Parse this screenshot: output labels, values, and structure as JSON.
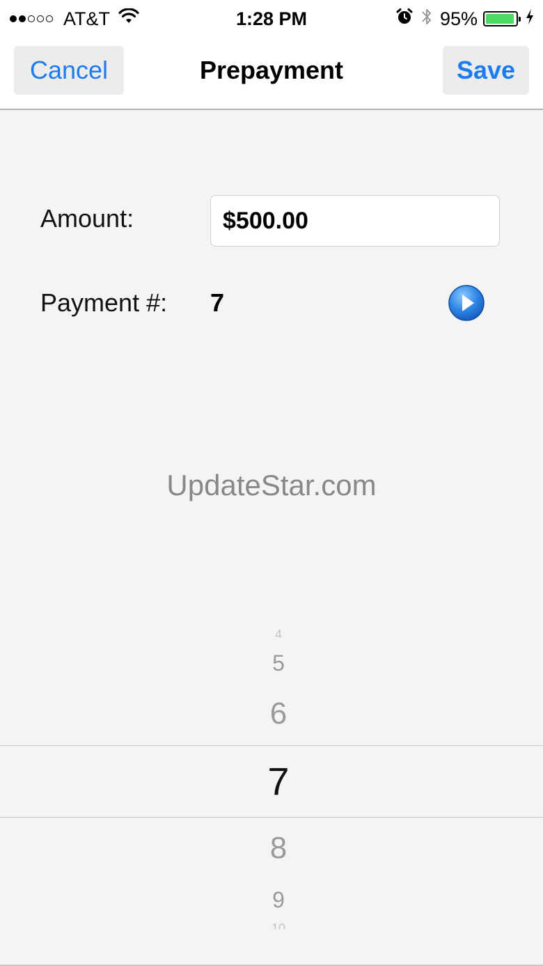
{
  "status_bar": {
    "carrier": "AT&T",
    "time": "1:28 PM",
    "battery_percent": "95%",
    "battery_level": 0.95,
    "signal_bars_filled": 2,
    "signal_bars_total": 5,
    "icons": [
      "wifi-icon",
      "alarm-icon",
      "bluetooth-icon",
      "battery-icon",
      "charging-icon"
    ]
  },
  "nav": {
    "title": "Prepayment",
    "cancel_label": "Cancel",
    "save_label": "Save"
  },
  "form": {
    "amount_label": "Amount:",
    "amount_value": "$500.00",
    "payment_label": "Payment #:",
    "payment_value": "7"
  },
  "watermark": "UpdateStar.com",
  "picker": {
    "items": [
      "4",
      "5",
      "6",
      "7",
      "8",
      "9",
      "10"
    ],
    "selected": "7"
  },
  "colors": {
    "accent": "#1a7cf0",
    "battery": "#4cd964",
    "background": "#f4f4f4"
  }
}
